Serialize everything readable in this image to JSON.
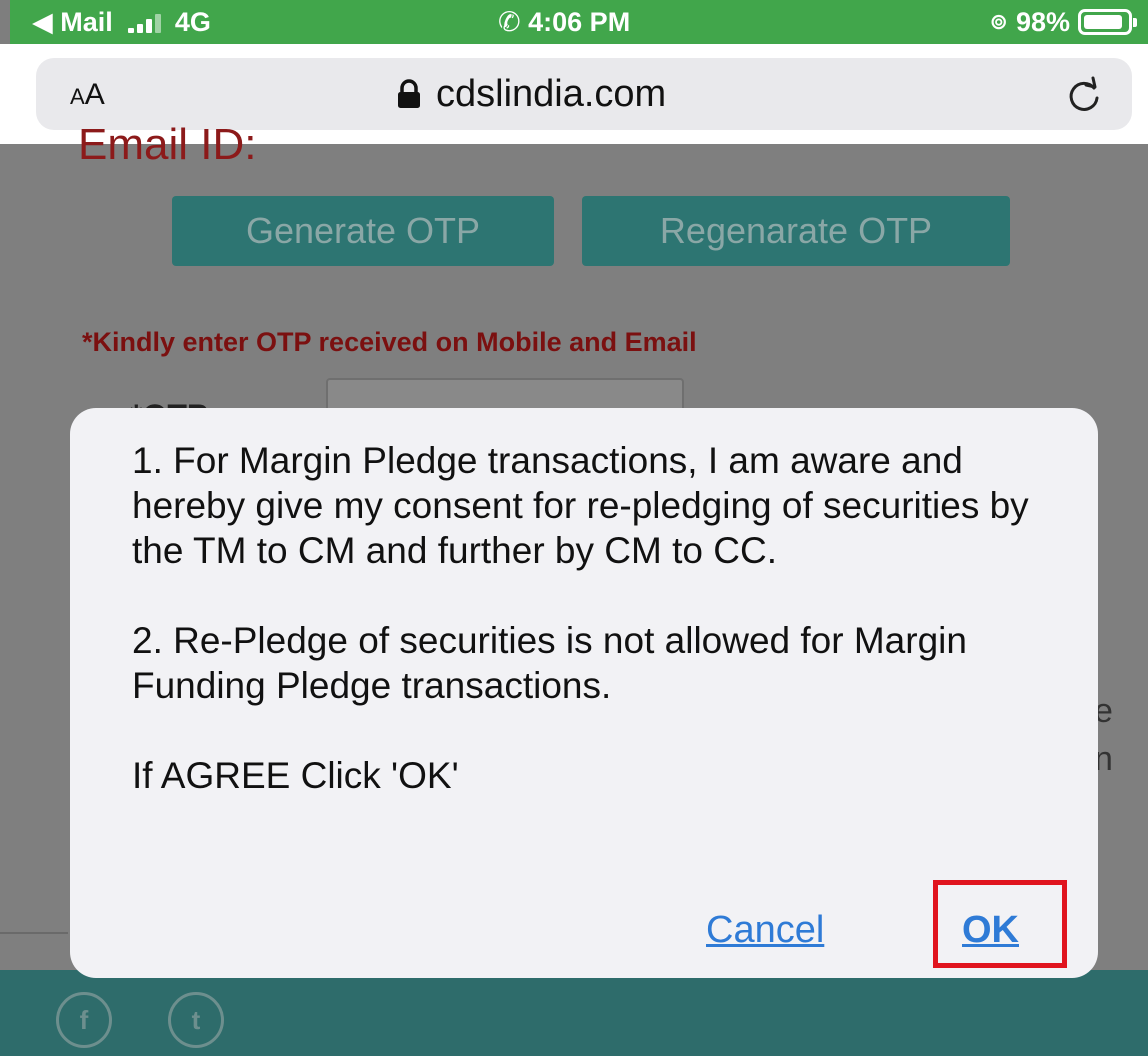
{
  "status_bar": {
    "back_app": "Mail",
    "network": "4G",
    "time": "4:06 PM",
    "battery": "98%"
  },
  "browser": {
    "text_size_label_small": "A",
    "text_size_label_large": "A",
    "url": "cdslindia.com"
  },
  "page": {
    "email_label": "Email ID:",
    "generate_otp_label": "Generate OTP",
    "regenerate_otp_label": "Regenarate OTP",
    "otp_note": "*Kindly enter OTP received on Mobile and Email",
    "otp_label": "*OTP",
    "edge_text_1": "e",
    "edge_text_2": "n"
  },
  "dialog": {
    "paragraph_1": "1. For Margin Pledge transactions, I am aware and hereby give my consent for re-pledging of securities by the TM to CM and further by CM to CC.",
    "paragraph_2": "2. Re-Pledge of securities is not allowed for Margin Funding Pledge transactions.",
    "paragraph_3": "If AGREE Click 'OK'",
    "cancel_label": "Cancel",
    "ok_label": "OK"
  },
  "footer": {
    "facebook_label": "f",
    "twitter_label": "t"
  },
  "colors": {
    "status_bar": "#41a64b",
    "dialog_bg": "#f2f2f5",
    "link_blue": "#2f7bd6",
    "highlight_red": "#e0141e"
  }
}
